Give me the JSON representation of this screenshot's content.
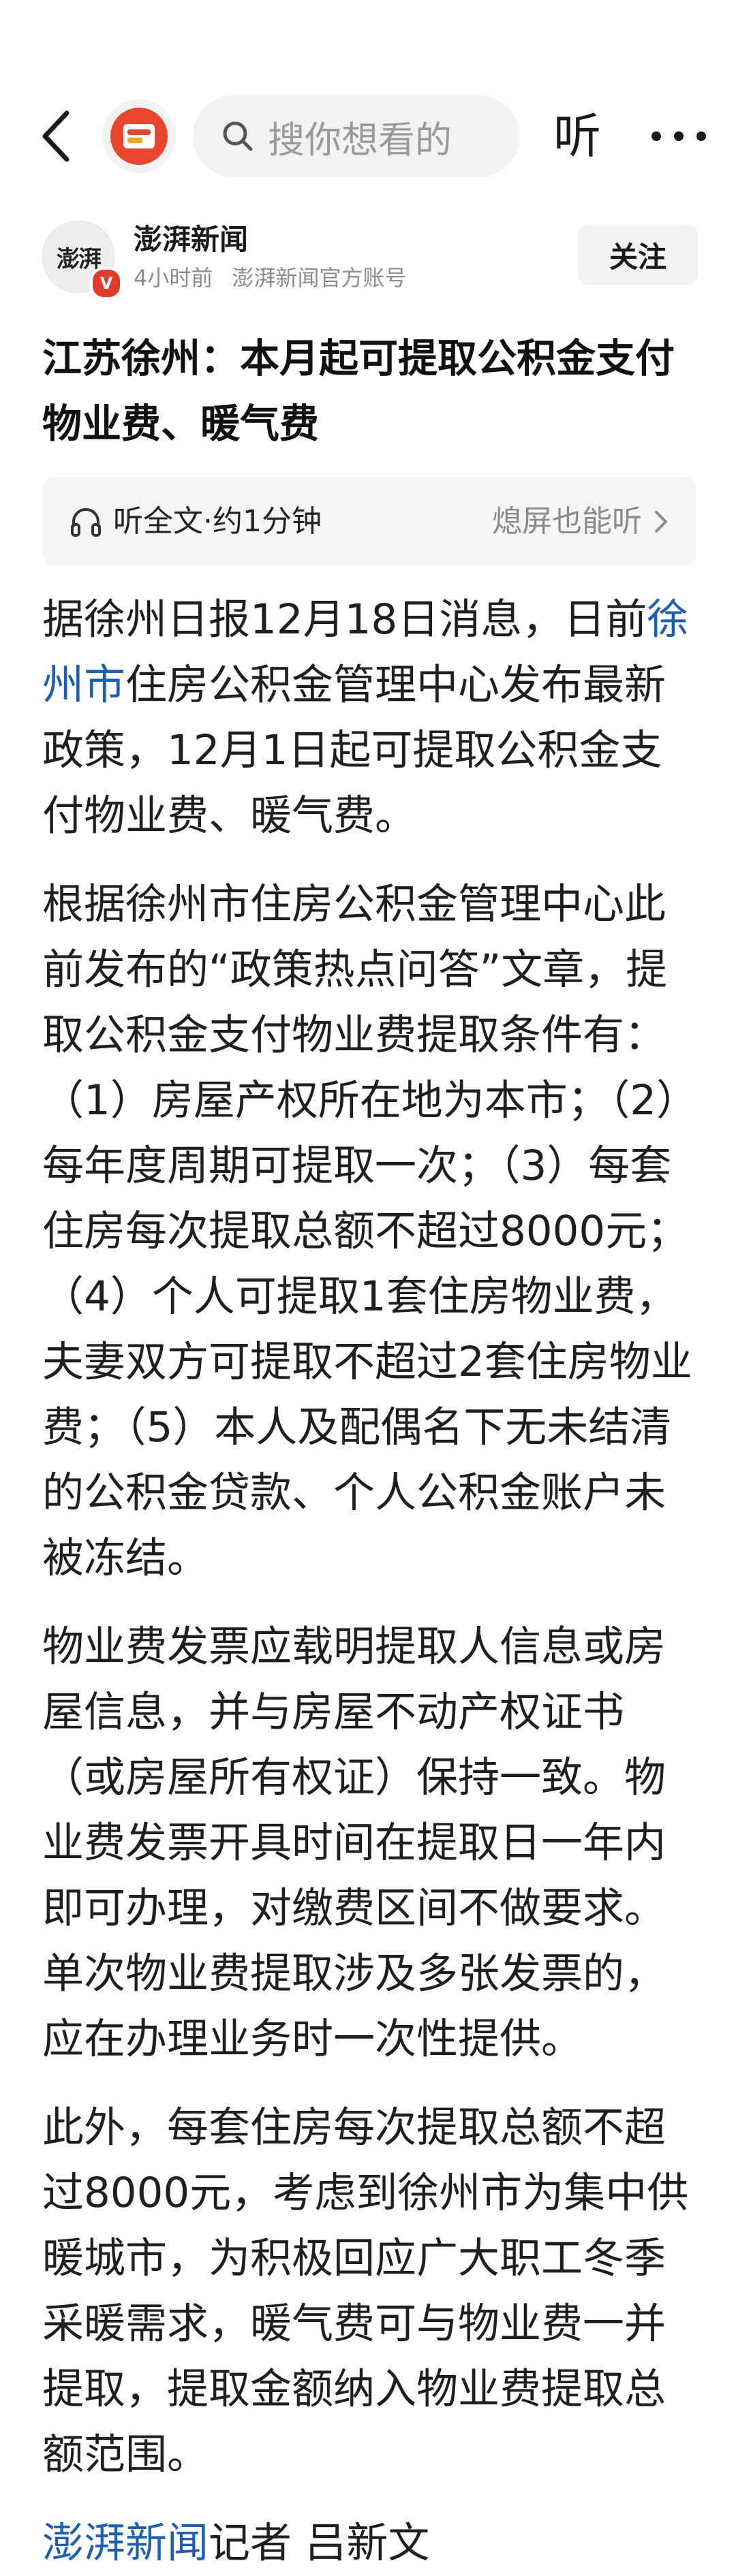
{
  "header": {
    "back_icon": "chevron-left-icon",
    "app_logo_icon": "thepaper-app-logo",
    "search_placeholder": "搜你想看的",
    "listen_label": "听",
    "more_icon": "more-dots-icon"
  },
  "author": {
    "avatar_text": "澎湃",
    "verified_badge": "V",
    "name": "澎湃新闻",
    "time": "4小时前",
    "account_desc": "澎湃新闻官方账号",
    "follow_label": "关注"
  },
  "article": {
    "title": "江苏徐州：本月起可提取公积金支付物业费、暖气费",
    "listen_bar": {
      "left_label": "听全文·约1分钟",
      "right_label": "熄屏也能听"
    },
    "p1_before": "据徐州日报12月18日消息，日前",
    "p1_link": "徐州市",
    "p1_after": "住房公积金管理中心发布最新政策，12月1日起可提取公积金支付物业费、暖气费。",
    "p2": "根据徐州市住房公积金管理中心此前发布的“政策热点问答”文章，提取公积金支付物业费提取条件有：（1）房屋产权所在地为本市；（2）每年度周期可提取一次；（3）每套住房每次提取总额不超过8000元；（4）个人可提取1套住房物业费，夫妻双方可提取不超过2套住房物业费；（5）本人及配偶名下无未结清的公积金贷款、个人公积金账户未被冻结。",
    "p3": "物业费发票应载明提取人信息或房屋信息，并与房屋不动产权证书（或房屋所有权证）保持一致。物业费发票开具时间在提取日一年内即可办理，对缴费区间不做要求。单次物业费提取涉及多张发票的，应在办理业务时一次性提供。",
    "p4": "此外，每套住房每次提取总额不超过8000元，考虑到徐州市为集中供暖城市，为积极回应广大职工冬季采暖需求，暖气费可与物业费一并提取，提取金额纳入物业费提取总额范围。",
    "byline_link": "澎湃新闻",
    "byline_text": "记者 吕新文"
  },
  "colors": {
    "link": "#1e5fb4",
    "brand_red": "#e8452f"
  }
}
